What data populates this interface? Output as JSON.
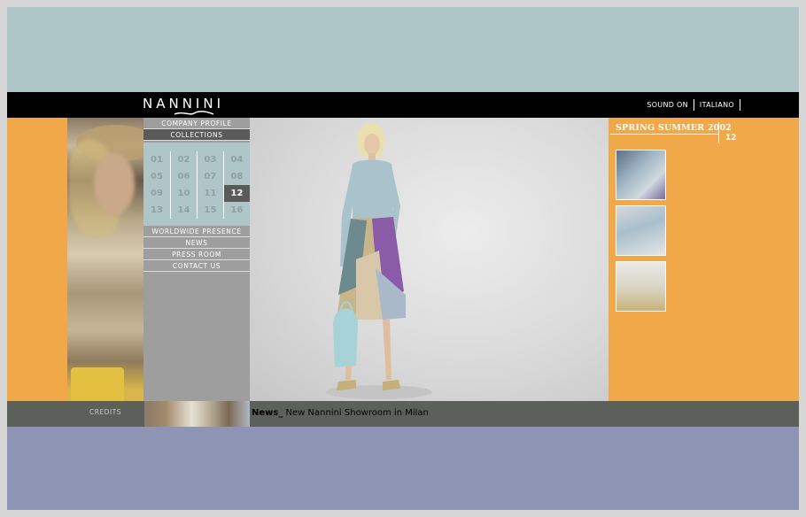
{
  "brand": {
    "logo_text": "NANNINI"
  },
  "top_links": [
    "SOUND ON",
    "ITALIANO"
  ],
  "nav": {
    "company_profile": "COMPANY PROFILE",
    "collections": "COLLECTIONS",
    "grid": [
      [
        "01",
        "02",
        "03",
        "04"
      ],
      [
        "05",
        "06",
        "07",
        "08"
      ],
      [
        "09",
        "10",
        "11",
        "12"
      ],
      [
        "13",
        "14",
        "15",
        "16"
      ]
    ],
    "active_cell": "12",
    "lower": [
      "WORLDWIDE PRESENCE",
      "NEWS",
      "PRESS ROOM",
      "CONTACT US"
    ]
  },
  "collection": {
    "season": "SPRING SUMMER 2002",
    "number": "12"
  },
  "footer": {
    "credits": "CREDITS",
    "news_label": "News_",
    "news_text": "New Nannini Showroom in Milan"
  },
  "colors": {
    "top_band": "#afc6c8",
    "header_bar": "#000000",
    "accent_orange": "#f0a848",
    "nav_gray": "#9e9e9e",
    "footer_bar": "#5c605a",
    "bottom_band": "#8e95b4"
  }
}
